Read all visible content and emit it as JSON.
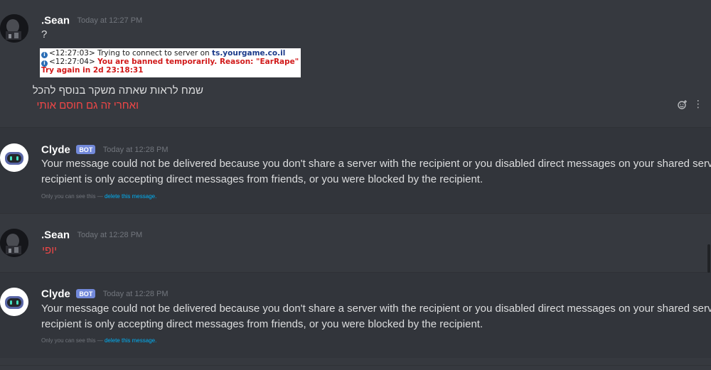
{
  "messages": [
    {
      "author": ".Sean",
      "timestamp": "Today at 12:27 PM",
      "lines": [
        "?"
      ],
      "embed": {
        "line1_time": "<12:27:03>",
        "line1_text": "Trying to connect to server on",
        "line1_server": "ts.yourgame.co.il",
        "line2_time": "<12:27:04>",
        "line2_text": "You are banned temporarily. Reason: \"EarRape\"",
        "line3_text": "Try again in 2d 23:18:31"
      },
      "hebrew_line1": "שמח לראות שאתה משקר בנוסף להכל",
      "hebrew_line2": "ואחרי זה גם חוסם אותי"
    },
    {
      "author": "Clyde",
      "bot_tag": "BOT",
      "timestamp": "Today at 12:28 PM",
      "line1": "Your message could not be delivered because you don't share a server with the recipient or you disabled direct messages on your shared server,",
      "line2": "recipient is only accepting direct messages from friends, or you were blocked by the recipient.",
      "ephemeral_text": "Only you can see this —",
      "ephemeral_link": "delete this message."
    },
    {
      "author": ".Sean",
      "timestamp": "Today at 12:28 PM",
      "line1": "יופי"
    },
    {
      "author": "Clyde",
      "bot_tag": "BOT",
      "timestamp": "Today at 12:28 PM",
      "line1": "Your message could not be delivered because you don't share a server with the recipient or you disabled direct messages on your shared server,",
      "line2": "recipient is only accepting direct messages from friends, or you were blocked by the recipient.",
      "ephemeral_text": "Only you can see this —",
      "ephemeral_link": "delete this message."
    }
  ],
  "icons": {
    "add_reaction": "add-reaction-icon",
    "more": "more-options-icon"
  },
  "colors": {
    "background": "#36393f",
    "clyde_background": "#32353b",
    "bot_tag": "#7289da",
    "link": "#00b0f4",
    "red_text": "#f04747"
  }
}
